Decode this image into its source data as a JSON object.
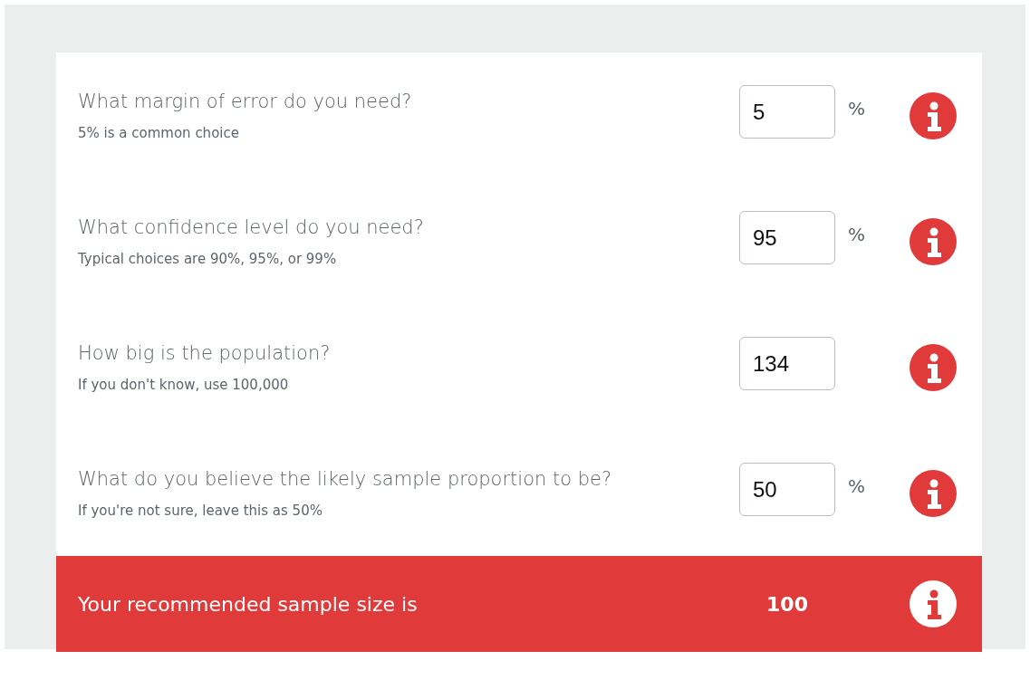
{
  "questions": [
    {
      "question": "What margin of error do you need?",
      "hint": "5% is a common choice",
      "value": "5",
      "unit": "%"
    },
    {
      "question": "What confidence level do you need?",
      "hint": "Typical choices are 90%, 95%, or 99%",
      "value": "95",
      "unit": "%"
    },
    {
      "question": "How big is the population?",
      "hint": "If you don't know, use 100,000",
      "value": "134"
    },
    {
      "question": "What do you believe the likely sample proportion to be?",
      "hint": "If you're not sure, leave this as 50%",
      "value": "50",
      "unit": "%"
    }
  ],
  "result": {
    "label": "Your recommended sample size is",
    "value": "100"
  }
}
